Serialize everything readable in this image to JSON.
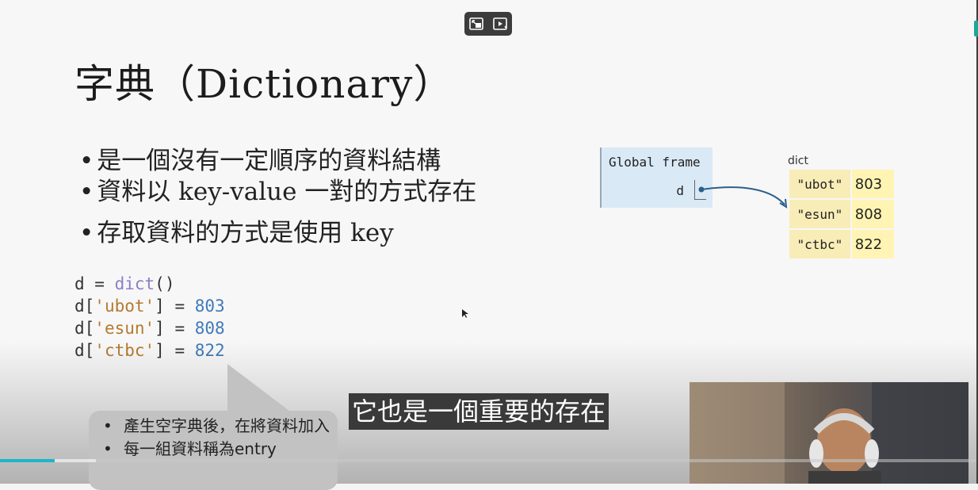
{
  "slide": {
    "title": "字典（Dictionary）",
    "bullets": [
      "是一個沒有一定順序的資料結構",
      "資料以 key-value 一對的方式存在",
      "存取資料的方式是使用 key"
    ],
    "code": {
      "line1": {
        "var": "d",
        "op": " = ",
        "fn": "dict",
        "paren": "()"
      },
      "lines": [
        {
          "prefix": "d[",
          "key": "'ubot'",
          "mid": "] = ",
          "value": "803"
        },
        {
          "prefix": "d[",
          "key": "'esun'",
          "mid": "] = ",
          "value": "808"
        },
        {
          "prefix": "d[",
          "key": "'ctbc'",
          "mid": "] = ",
          "value": "822"
        }
      ]
    },
    "diagram": {
      "frame_title": "Global frame",
      "frame_var": "d",
      "dict_label": "dict",
      "rows": [
        {
          "key": "\"ubot\"",
          "value": "803"
        },
        {
          "key": "\"esun\"",
          "value": "808"
        },
        {
          "key": "\"ctbc\"",
          "value": "822"
        }
      ]
    },
    "callout": [
      "產生空字典後，在將資料加入",
      "每一組資料稱為entry"
    ]
  },
  "subtitle": "它也是一個重要的存在",
  "player": {
    "progress_fraction": 0.056,
    "buffer_fraction": 0.098,
    "accent": "#1fb6c8",
    "icons": [
      "miniplayer-icon",
      "autoplay-icon"
    ]
  }
}
